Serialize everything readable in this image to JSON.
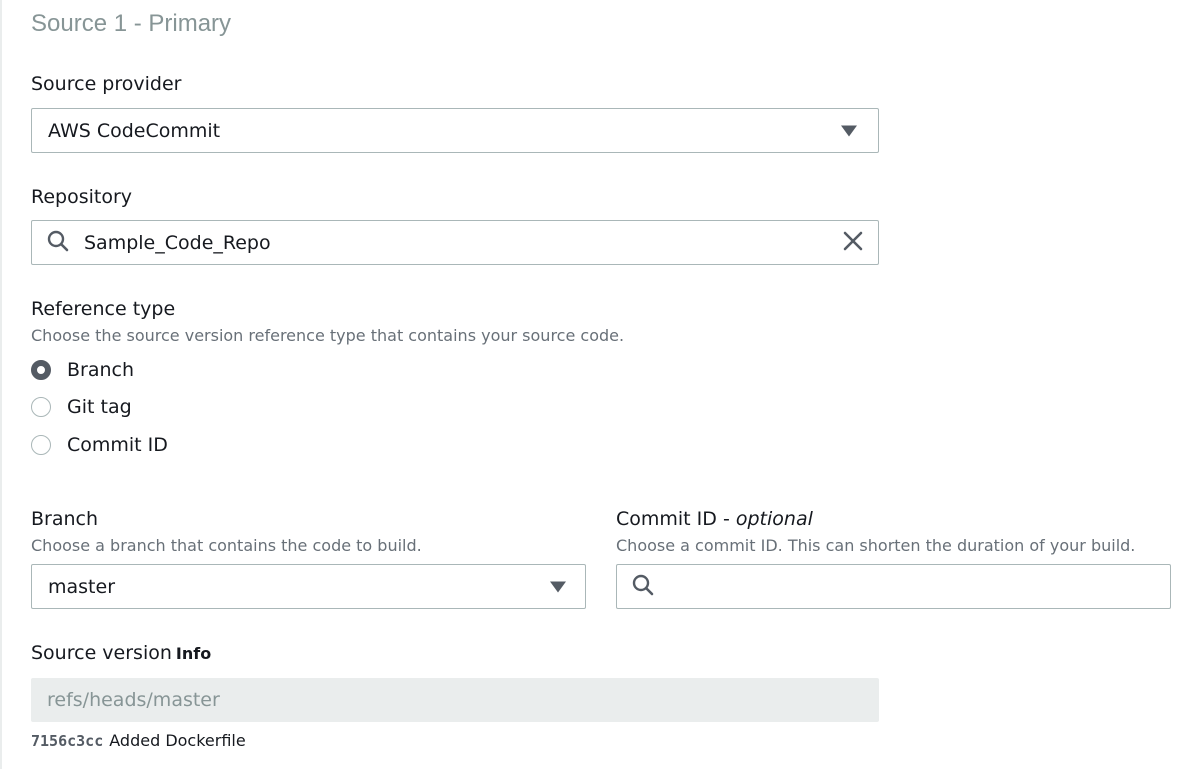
{
  "section": {
    "title": "Source 1 - Primary"
  },
  "source_provider": {
    "label": "Source provider",
    "value": "AWS CodeCommit"
  },
  "repository": {
    "label": "Repository",
    "value": "Sample_Code_Repo"
  },
  "reference_type": {
    "label": "Reference type",
    "description": "Choose the source version reference type that contains your source code.",
    "options": [
      {
        "label": "Branch",
        "checked": true
      },
      {
        "label": "Git tag",
        "checked": false
      },
      {
        "label": "Commit ID",
        "checked": false
      }
    ]
  },
  "branch": {
    "label": "Branch",
    "description": "Choose a branch that contains the code to build.",
    "value": "master"
  },
  "commit_id": {
    "label": "Commit ID",
    "label_suffix_sep": " - ",
    "label_suffix": "optional",
    "description": "Choose a commit ID. This can shorten the duration of your build.",
    "value": ""
  },
  "source_version": {
    "label": "Source version",
    "info": "Info",
    "value": "refs/heads/master",
    "commit_hash": "7156c3cc",
    "commit_message": "Added Dockerfile"
  },
  "colors": {
    "text": "#16191f",
    "muted": "#687078",
    "title": "#879596",
    "border": "#aab7b8",
    "disabled_bg": "#eaeded"
  }
}
